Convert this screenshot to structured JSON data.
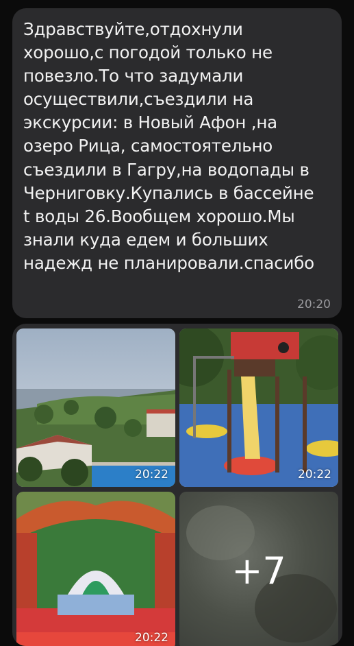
{
  "message": {
    "text": "Здравствуйте,отдохнули\nхорошо,с погодой только не\nповезло.То что задумали\nосуществили,съездили на\nэкскурсии: в Новый Афон ,на\nозеро Рица, самостоятельно\nсъездили в Гагру,на водопады в\nЧерниговку.Купались в бассейне\nt воды 26.Вообщем хорошо.Мы\nзнали куда едем и больших\nнадежд не планировали.спасибо",
    "time": "20:20"
  },
  "gallery": {
    "photos": [
      {
        "time": "20:22",
        "icon": "resort-coast-photo"
      },
      {
        "time": "20:22",
        "icon": "playground-slide-photo"
      },
      {
        "time": "20:22",
        "icon": "inflatable-bouncy-castle-photo"
      },
      {
        "time": "",
        "icon": "blurred-photo"
      }
    ],
    "more_count": "+7"
  },
  "colors": {
    "background": "#0b0b0b",
    "bubble": "#2b2b2d",
    "text": "#f2f2f2",
    "time": "#9a9a9e"
  }
}
